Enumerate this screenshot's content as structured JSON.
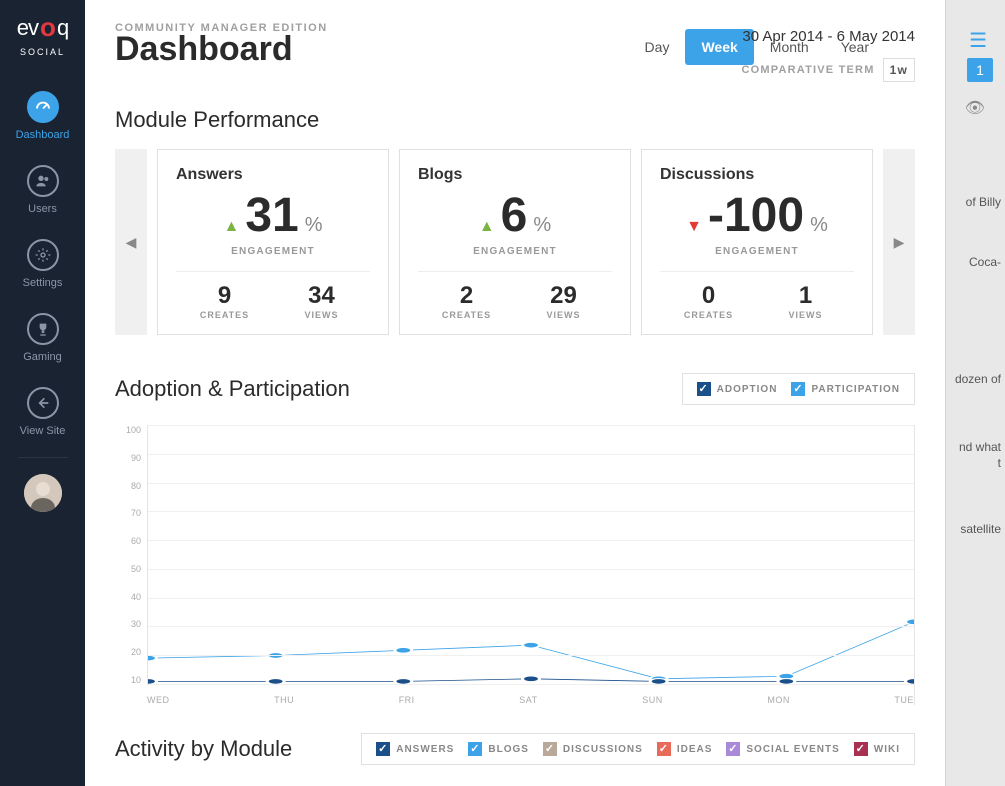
{
  "brand": {
    "name": "evoq",
    "subtitle": "SOCIAL"
  },
  "sidebar": {
    "items": [
      {
        "label": "Dashboard",
        "active": true
      },
      {
        "label": "Users"
      },
      {
        "label": "Settings"
      },
      {
        "label": "Gaming"
      },
      {
        "label": "View Site"
      }
    ]
  },
  "header": {
    "edition": "COMMUNITY MANAGER EDITION",
    "title": "Dashboard",
    "date_range": "30 Apr 2014 - 6 May 2014",
    "periods": [
      "Day",
      "Week",
      "Month",
      "Year"
    ],
    "active_period": "Week",
    "comparative_label": "COMPARATIVE TERM",
    "comparative_value": "1w"
  },
  "module_perf": {
    "title": "Module Performance",
    "cards": [
      {
        "title": "Answers",
        "trend": "up",
        "value": "31",
        "unit": "%",
        "sub": "ENGAGEMENT",
        "creates": "9",
        "creates_label": "CREATES",
        "views": "34",
        "views_label": "VIEWS"
      },
      {
        "title": "Blogs",
        "trend": "up",
        "value": "6",
        "unit": "%",
        "sub": "ENGAGEMENT",
        "creates": "2",
        "creates_label": "CREATES",
        "views": "29",
        "views_label": "VIEWS"
      },
      {
        "title": "Discussions",
        "trend": "down",
        "value": "-100",
        "unit": "%",
        "sub": "ENGAGEMENT",
        "creates": "0",
        "creates_label": "CREATES",
        "views": "1",
        "views_label": "VIEWS"
      }
    ]
  },
  "adoption": {
    "title": "Adoption & Participation",
    "legend": [
      {
        "label": "ADOPTION",
        "color": "#1a4f8a",
        "checked": true
      },
      {
        "label": "PARTICIPATION",
        "color": "#3ca3e8",
        "checked": true
      }
    ]
  },
  "chart_data": {
    "type": "line",
    "x": [
      "WED",
      "THU",
      "FRI",
      "SAT",
      "SUN",
      "MON",
      "TUE"
    ],
    "y_ticks": [
      100,
      90,
      80,
      70,
      60,
      50,
      40,
      30,
      20,
      10
    ],
    "ylim": [
      0,
      100
    ],
    "series": [
      {
        "name": "Participation",
        "color": "#3ca3e8",
        "values": [
          10,
          11,
          13,
          15,
          2,
          3,
          24
        ]
      },
      {
        "name": "Adoption",
        "color": "#1a4f8a",
        "values": [
          1,
          1,
          1,
          2,
          1,
          1,
          1
        ]
      }
    ]
  },
  "activity": {
    "title": "Activity by Module",
    "legend": [
      {
        "label": "ANSWERS",
        "color": "#1a4f8a"
      },
      {
        "label": "BLOGS",
        "color": "#3ca3e8"
      },
      {
        "label": "DISCUSSIONS",
        "color": "#b8a99a"
      },
      {
        "label": "IDEAS",
        "color": "#e86a5a"
      },
      {
        "label": "SOCIAL EVENTS",
        "color": "#a88ad8"
      },
      {
        "label": "WIKI",
        "color": "#a83050"
      }
    ]
  },
  "right_panel": {
    "badge": "1",
    "fragments": [
      "of Billy",
      "Coca-",
      "dozen of",
      "nd what",
      "t",
      "satellite"
    ]
  }
}
